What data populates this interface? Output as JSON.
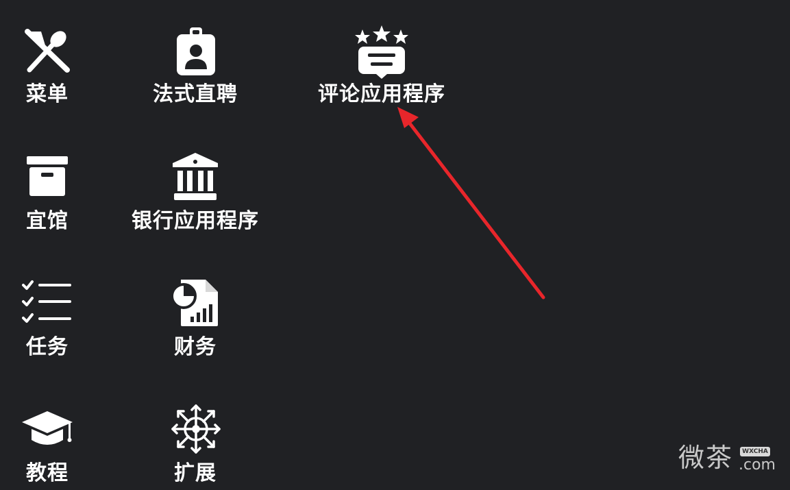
{
  "apps": [
    {
      "id": "menu",
      "label": "菜单",
      "icon": "utensils-icon"
    },
    {
      "id": "legal",
      "label": "法式直聘",
      "icon": "id-badge-icon"
    },
    {
      "id": "review",
      "label": "评论应用程序",
      "icon": "rating-review-icon"
    },
    {
      "id": "venue",
      "label": "宜馆",
      "icon": "archive-box-icon"
    },
    {
      "id": "bank",
      "label": "银行应用程序",
      "icon": "bank-icon"
    },
    {
      "id": "tasks",
      "label": "任务",
      "icon": "task-list-icon"
    },
    {
      "id": "finance",
      "label": "财务",
      "icon": "finance-report-icon"
    },
    {
      "id": "tutorial",
      "label": "教程",
      "icon": "graduation-cap-icon"
    },
    {
      "id": "extensions",
      "label": "扩展",
      "icon": "expand-network-icon"
    }
  ],
  "annotation": {
    "color": "#e8262b",
    "icon": "red-arrow-icon"
  },
  "watermark": {
    "text": "微茶",
    "badge": "WXCHA",
    "domain": ".com"
  }
}
